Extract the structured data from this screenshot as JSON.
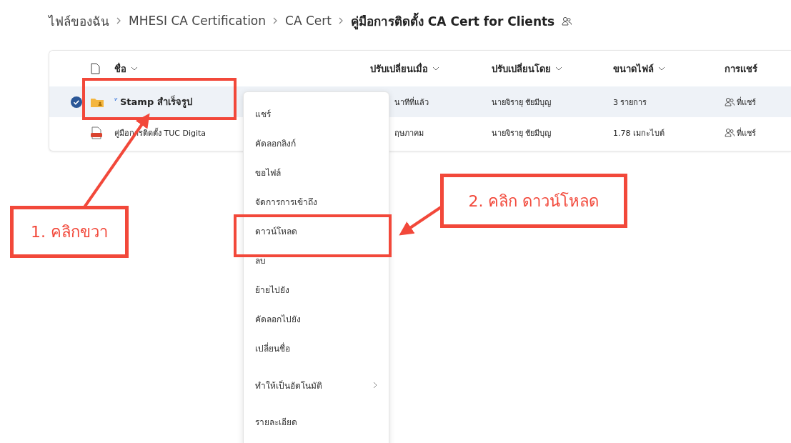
{
  "breadcrumb": [
    {
      "label": "ไฟล์ของฉัน",
      "current": false
    },
    {
      "label": "MHESI CA Certification",
      "current": false
    },
    {
      "label": "CA Cert",
      "current": false
    },
    {
      "label": "คู่มือการติดตั้ง CA Cert for Clients",
      "current": true
    }
  ],
  "table": {
    "columns": [
      {
        "label": "ชื่อ",
        "sortable": true
      },
      {
        "label": "ปรับเปลี่ยนเมื่อ",
        "sortable": true
      },
      {
        "label": "ปรับเปลี่ยนโดย",
        "sortable": true
      },
      {
        "label": "ขนาดไฟล์",
        "sortable": true
      },
      {
        "label": "การแชร์",
        "sortable": false
      }
    ],
    "rows": [
      {
        "kind": "folder",
        "selected": true,
        "name": "Stamp สำเร็จรูป",
        "modified": "นาทีที่แล้ว",
        "modified_by": "นายจิรายุ ชัยมีบุญ",
        "size": "3 รายการ",
        "sharing": "ที่แชร์"
      },
      {
        "kind": "pdf",
        "selected": false,
        "name": "คู่มือการติดตั้ง TUC Digita",
        "modified": "ฤษภาคม",
        "modified_by": "นายจิรายุ ชัยมีบุญ",
        "size": "1.78 เมกะไบต์",
        "sharing": "ที่แชร์"
      }
    ]
  },
  "context_menu": [
    {
      "label": "แชร์",
      "kind": "item"
    },
    {
      "label": "คัดลอกลิงก์",
      "kind": "item"
    },
    {
      "label": "ขอไฟล์",
      "kind": "item"
    },
    {
      "label": "จัดการการเข้าถึง",
      "kind": "item"
    },
    {
      "label": "ดาวน์โหลด",
      "kind": "item"
    },
    {
      "label": "ลบ",
      "kind": "item"
    },
    {
      "label": "ย้ายไปยัง",
      "kind": "item"
    },
    {
      "label": "คัดลอกไปยัง",
      "kind": "item"
    },
    {
      "label": "เปลี่ยนชื่อ",
      "kind": "item"
    },
    {
      "label": "ทำให้เป็นอัตโนมัติ",
      "kind": "submenu"
    },
    {
      "label": "รายละเอียด",
      "kind": "item"
    }
  ],
  "callouts": [
    "1. คลิกขวา",
    "2. คลิก ดาวน์โหลด"
  ]
}
